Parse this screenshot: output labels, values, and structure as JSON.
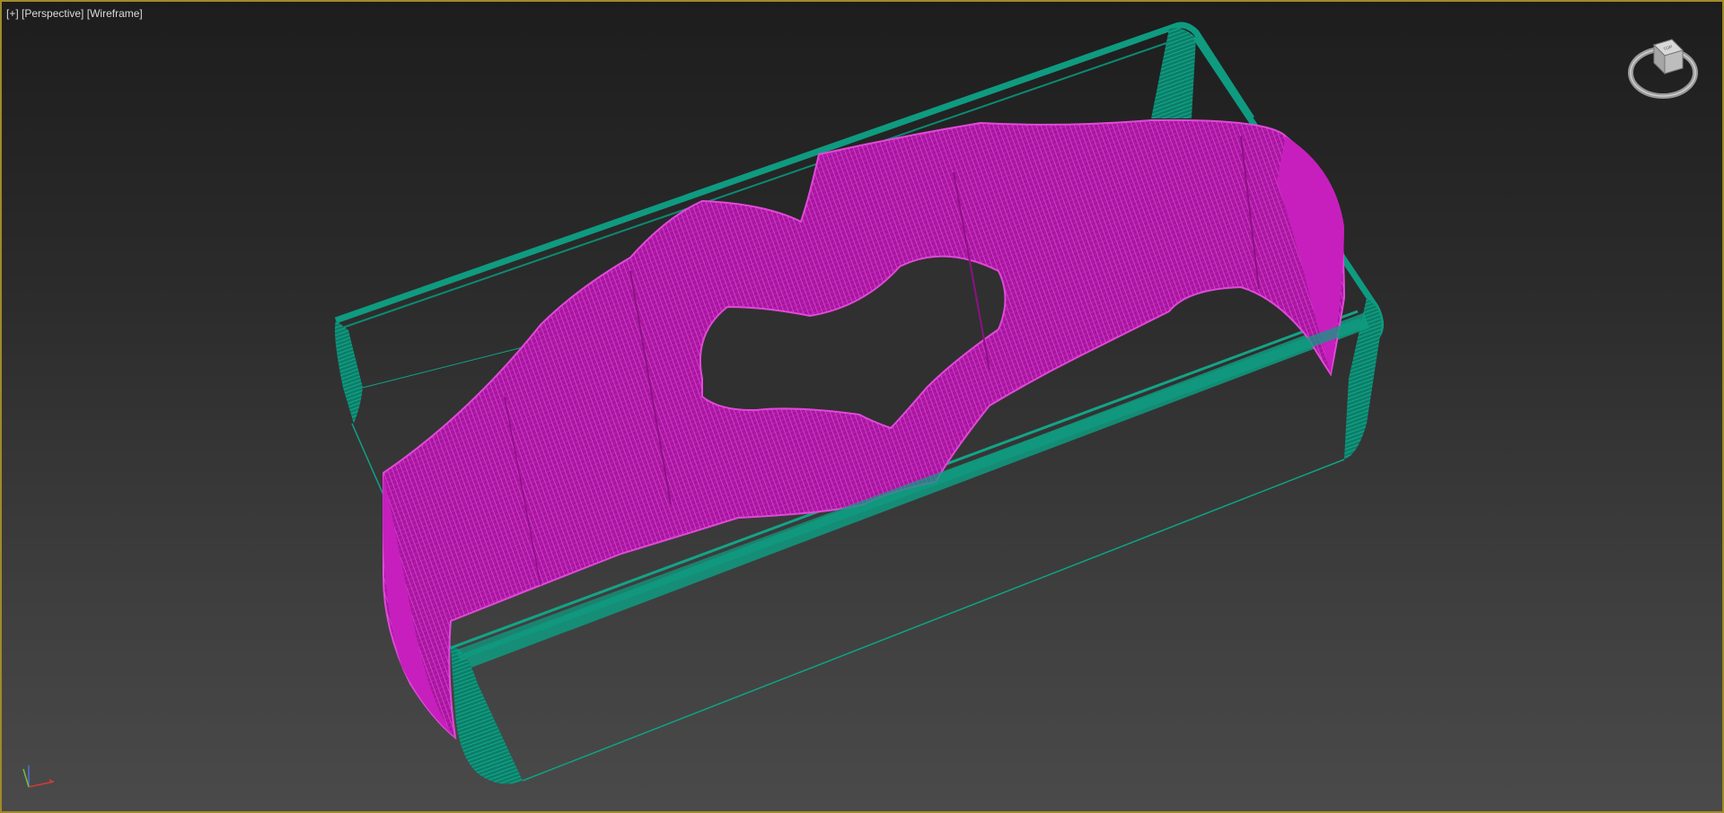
{
  "viewport": {
    "label_plus": "[+]",
    "label_view": "[Perspective]",
    "label_shading": "[Wireframe]"
  },
  "scene_objects": [
    {
      "name": "rounded-box-wireframe",
      "color": "#0f9b80"
    },
    {
      "name": "heart-hands-mesh-wireframe",
      "color": "#c71fbe"
    }
  ],
  "viewcube": {
    "icon": "viewcube-icon",
    "face_label": "TOP"
  },
  "axis": {
    "x_color": "#d23a3a",
    "y_color": "#6fbf3a",
    "z_color": "#4f6fd8"
  },
  "colors": {
    "border": "#a08a2a",
    "wire_teal": "#0f9b80",
    "wire_magenta": "#c71fbe"
  }
}
